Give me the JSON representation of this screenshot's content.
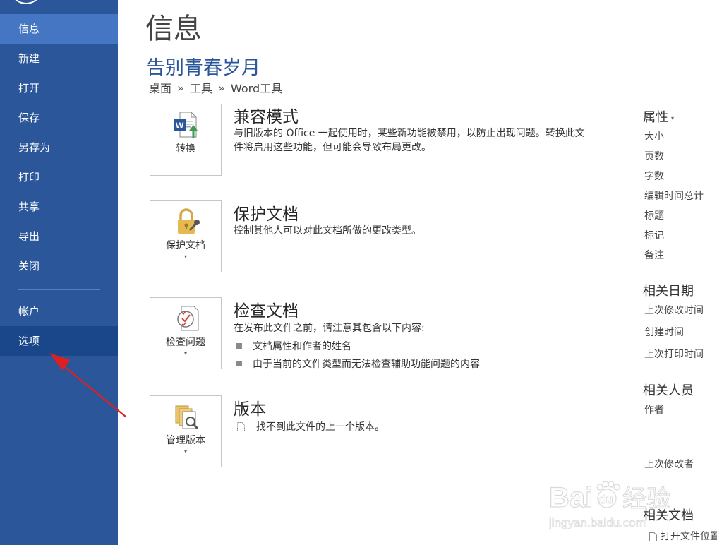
{
  "sidebar": {
    "items": [
      {
        "label": "信息"
      },
      {
        "label": "新建"
      },
      {
        "label": "打开"
      },
      {
        "label": "保存"
      },
      {
        "label": "另存为"
      },
      {
        "label": "打印"
      },
      {
        "label": "共享"
      },
      {
        "label": "导出"
      },
      {
        "label": "关闭"
      },
      {
        "label": "帐户"
      },
      {
        "label": "选项"
      }
    ]
  },
  "page": {
    "title": "信息",
    "doc_title": "告别青春岁月",
    "breadcrumb": [
      "桌面",
      "工具",
      "Word工具"
    ],
    "breadcrumb_sep": "»"
  },
  "sections": [
    {
      "tile_label": "转换",
      "title": "兼容模式",
      "desc": "与旧版本的 Office 一起使用时，某些新功能被禁用，以防止出现问题。转换此文件将启用这些功能，但可能会导致布局更改。"
    },
    {
      "tile_label": "保护文档",
      "title": "保护文档",
      "desc": "控制其他人可以对此文档所做的更改类型。"
    },
    {
      "tile_label": "检查问题",
      "title": "检查文档",
      "desc": "在发布此文件之前，请注意其包含以下内容:",
      "bullets": [
        "文档属性和作者的姓名",
        "由于当前的文件类型而无法检查辅助功能问题的内容"
      ]
    },
    {
      "tile_label": "管理版本",
      "title": "版本",
      "desc": "找不到此文件的上一个版本。"
    }
  ],
  "properties": {
    "heading": "属性",
    "caret": "▾",
    "items": [
      "大小",
      "页数",
      "字数",
      "编辑时间总计",
      "标题",
      "标记",
      "备注"
    ],
    "dates_heading": "相关日期",
    "dates": [
      "上次修改时间",
      "创建时间",
      "上次打印时间"
    ],
    "people_heading": "相关人员",
    "author_label": "作者",
    "last_modified_by": "上次修改者",
    "docs_heading": "相关文档",
    "open_location": "打开文件位置"
  },
  "tile_caret": "▾",
  "watermark": {
    "brand": "Baidu",
    "brand_cn": "经验",
    "url": "jingyan.baidu.com"
  },
  "colors": {
    "sidebar": "#2b579a",
    "sidebar_active": "#4476c4",
    "sidebar_hover": "#19478a",
    "accent": "#2b579a",
    "arrow": "#e02020"
  }
}
